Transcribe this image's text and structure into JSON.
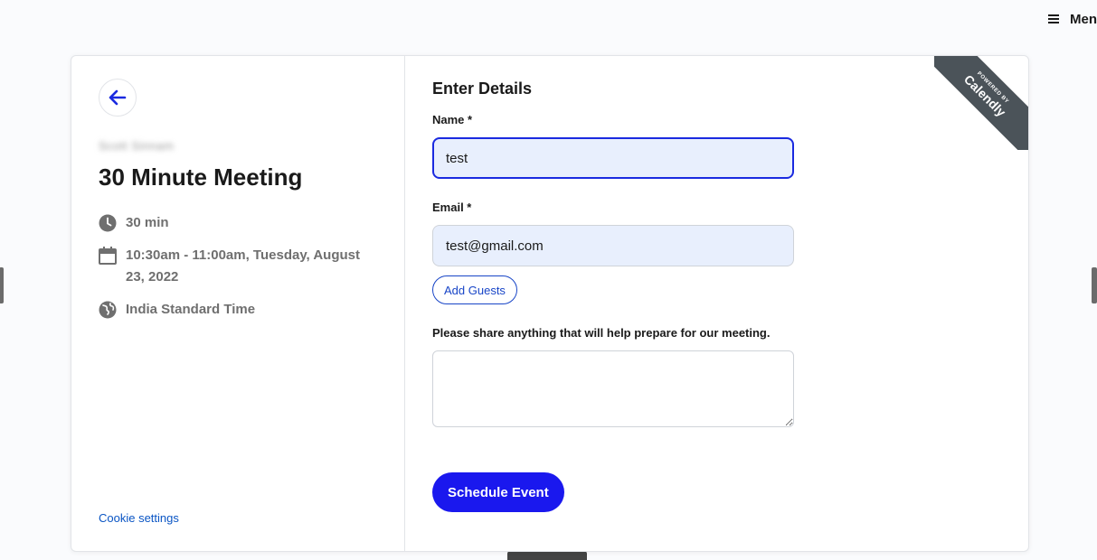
{
  "top_menu": {
    "icon": "hamburger-menu-icon",
    "label": "Men"
  },
  "event": {
    "organizer": "Scott Sinnam",
    "title": "30 Minute Meeting",
    "duration": "30 min",
    "datetime": "10:30am - 11:00am, Tuesday, August 23, 2022",
    "timezone": "India Standard Time"
  },
  "footer": {
    "cookie_settings": "Cookie settings"
  },
  "form": {
    "heading": "Enter Details",
    "name_label": "Name *",
    "name_value": "test",
    "email_label": "Email *",
    "email_value": "test@gmail.com",
    "add_guests_label": "Add Guests",
    "notes_label": "Please share anything that will help prepare for our meeting.",
    "notes_value": "",
    "submit_label": "Schedule Event"
  },
  "badge": {
    "powered_by": "POWERED BY",
    "brand": "Calendly"
  },
  "colors": {
    "accent": "#1a18ee",
    "link": "#0a55c4",
    "input_fill": "#e8effd",
    "ribbon": "#4b5359"
  }
}
